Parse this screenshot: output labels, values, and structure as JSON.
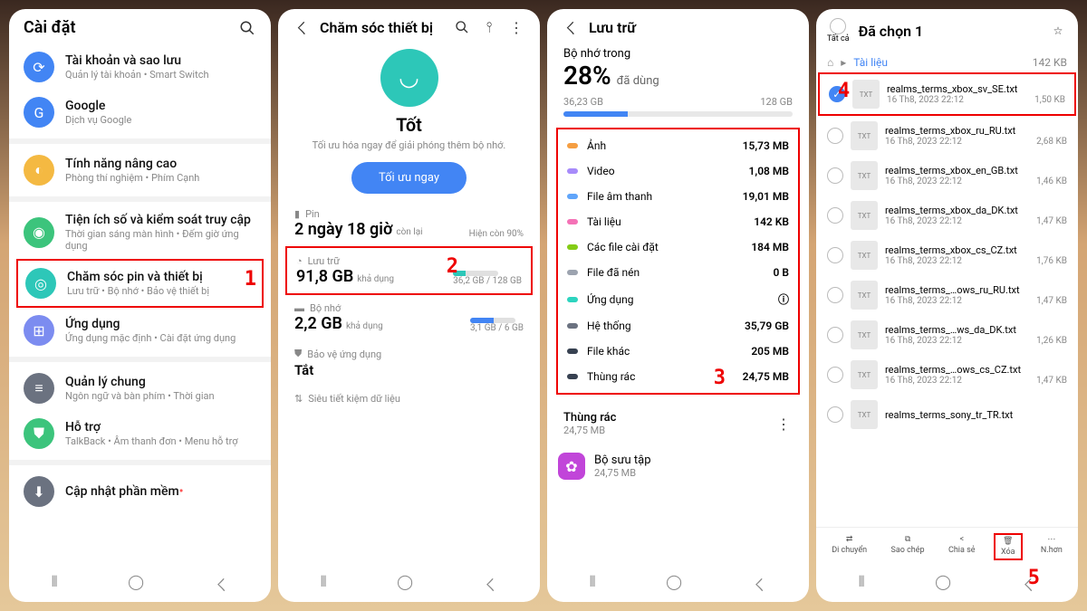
{
  "p1": {
    "title": "Cài đặt",
    "items": [
      {
        "icon": "⟳",
        "bg": "#4285f4",
        "title": "Tài khoản và sao lưu",
        "sub": "Quản lý tài khoản • Smart Switch"
      },
      {
        "icon": "G",
        "bg": "#4285f4",
        "title": "Google",
        "sub": "Dịch vụ Google"
      },
      {
        "icon": "◐",
        "bg": "#f4b942",
        "title": "Tính năng nâng cao",
        "sub": "Phòng thí nghiệm • Phím Cạnh"
      },
      {
        "icon": "◉",
        "bg": "#3cc47c",
        "title": "Tiện ích số và kiểm soát truy cập",
        "sub": "Thời gian sáng màn hình • Đếm giờ ứng dụng"
      },
      {
        "icon": "◎",
        "bg": "#2dc7b8",
        "title": "Chăm sóc pin và thiết bị",
        "sub": "Lưu trữ • Bộ nhớ • Bảo vệ thiết bị",
        "hl": true,
        "num": "1"
      },
      {
        "icon": "⊞",
        "bg": "#7c8cf0",
        "title": "Ứng dụng",
        "sub": "Ứng dụng mặc định • Cài đặt ứng dụng"
      },
      {
        "icon": "≡",
        "bg": "#6b7280",
        "title": "Quản lý chung",
        "sub": "Ngôn ngữ và bàn phím • Thời gian"
      },
      {
        "icon": "⛊",
        "bg": "#3cc47c",
        "title": "Hỗ trợ",
        "sub": "TalkBack • Âm thanh đơn • Menu hỗ trợ"
      },
      {
        "icon": "⬇",
        "bg": "#6b7280",
        "title": "Cập nhật phần mềm",
        "sub": "",
        "dot": true
      }
    ]
  },
  "p2": {
    "title": "Chăm sóc thiết bị",
    "status": "Tốt",
    "status_sub": "Tối ưu hóa ngay để giải phóng thêm bộ nhớ.",
    "btn": "Tối ưu ngay",
    "pin_lbl": "Pin",
    "pin_val": "2 ngày 18 giờ",
    "pin_sub": "còn lại",
    "pin_pct": "Hiện còn 90%",
    "storage_lbl": "Lưu trữ",
    "storage_val": "91,8 GB",
    "storage_sub": "khả dụng",
    "storage_range": "36,2 GB / 128 GB",
    "num": "2",
    "mem_lbl": "Bộ nhớ",
    "mem_val": "2,2 GB",
    "mem_sub": "khả dụng",
    "mem_range": "3,1 GB / 6 GB",
    "protect_lbl": "Bảo vệ ứng dụng",
    "protect_val": "Tắt",
    "save_lbl": "Siêu tiết kiệm dữ liệu"
  },
  "p3": {
    "title": "Lưu trữ",
    "sub1": "Bộ nhớ trong",
    "pct": "28%",
    "pct_lbl": "đã dùng",
    "used": "36,23 GB",
    "total": "128 GB",
    "cats": [
      {
        "c": "#f59e42",
        "n": "Ảnh",
        "v": "15,73 MB"
      },
      {
        "c": "#a78bfa",
        "n": "Video",
        "v": "1,08 MB"
      },
      {
        "c": "#60a5fa",
        "n": "File âm thanh",
        "v": "19,01 MB"
      },
      {
        "c": "#f472b6",
        "n": "Tài liệu",
        "v": "142 KB"
      },
      {
        "c": "#84cc16",
        "n": "Các file cài đặt",
        "v": "184 MB"
      },
      {
        "c": "#9ca3af",
        "n": "File đã nén",
        "v": "0 B"
      },
      {
        "c": "#2dd4bf",
        "n": "Ứng dụng",
        "v": "ⓘ"
      },
      {
        "c": "#6b7280",
        "n": "Hệ thống",
        "v": "35,79 GB"
      },
      {
        "c": "#374151",
        "n": "File khác",
        "v": "205 MB"
      },
      {
        "c": "#374151",
        "n": "Thùng rác",
        "v": "24,75 MB"
      }
    ],
    "num": "3",
    "trash_title": "Thùng rác",
    "trash_sub": "24,75 MB",
    "coll_title": "Bộ sưu tập",
    "coll_sub": "24,75 MB"
  },
  "p4": {
    "all_lbl": "Tất cả",
    "title": "Đã chọn 1",
    "crumb": "Tài liệu",
    "crumb_size": "142 KB",
    "files": [
      {
        "n": "realms_terms_xbox_sv_SE.txt",
        "d": "16 Th8, 2023 22:12",
        "s": "1,50 KB",
        "sel": true,
        "hl": true,
        "num": "4"
      },
      {
        "n": "realms_terms_xbox_ru_RU.txt",
        "d": "16 Th8, 2023 22:12",
        "s": "2,68 KB"
      },
      {
        "n": "realms_terms_xbox_en_GB.txt",
        "d": "16 Th8, 2023 22:12",
        "s": "1,46 KB"
      },
      {
        "n": "realms_terms_xbox_da_DK.txt",
        "d": "16 Th8, 2023 22:12",
        "s": "1,47 KB"
      },
      {
        "n": "realms_terms_xbox_cs_CZ.txt",
        "d": "16 Th8, 2023 22:12",
        "s": "1,76 KB"
      },
      {
        "n": "realms_terms_…ows_ru_RU.txt",
        "d": "16 Th8, 2023 22:12",
        "s": "1,47 KB"
      },
      {
        "n": "realms_terms_…ws_da_DK.txt",
        "d": "16 Th8, 2023 22:12",
        "s": "1,26 KB"
      },
      {
        "n": "realms_terms_…ows_cs_CZ.txt",
        "d": "16 Th8, 2023 22:12",
        "s": "1,47 KB"
      },
      {
        "n": "realms_terms_sony_tr_TR.txt",
        "d": "",
        "s": ""
      }
    ],
    "actions": [
      "Di chuyển",
      "Sao chép",
      "Chia sẻ",
      "Xóa",
      "N.hơn"
    ],
    "num": "5"
  }
}
